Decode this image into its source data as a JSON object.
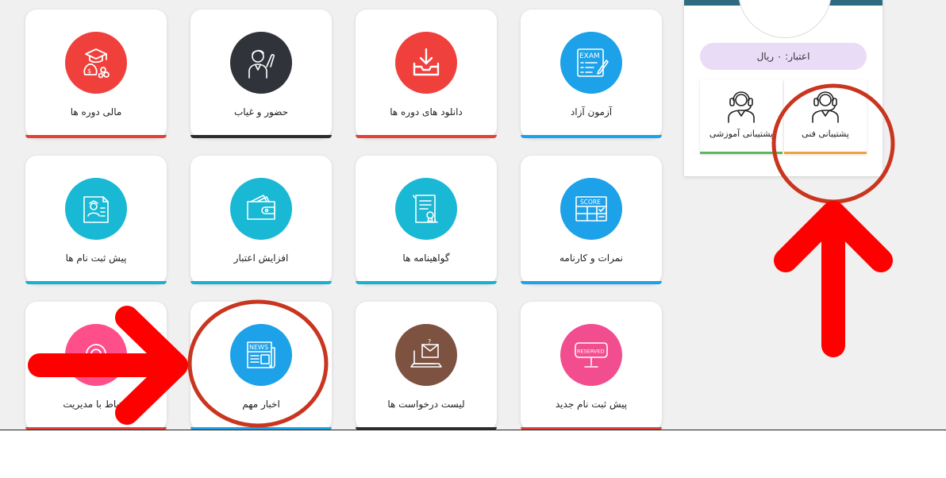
{
  "cards": [
    {
      "label": "مالی دوره ها",
      "icon": "financial-graduation-icon",
      "circle_color": "#f0403c",
      "bar_color": "#e0413a"
    },
    {
      "label": "حضور و غیاب",
      "icon": "attendance-person-icon",
      "circle_color": "#30343a",
      "bar_color": "#2b2d30"
    },
    {
      "label": "دانلود های دوره ها",
      "icon": "download-tray-icon",
      "circle_color": "#f0403c",
      "bar_color": "#e0413a"
    },
    {
      "label": "آزمون آزاد",
      "icon": "exam-icon",
      "circle_color": "#1da1e8",
      "bar_color": "#1da1e8"
    },
    {
      "label": "پیش ثبت نام ها",
      "icon": "pre-registration-icon",
      "circle_color": "#19b8d4",
      "bar_color": "#19b0d0"
    },
    {
      "label": "افزایش اعتبار",
      "icon": "wallet-icon",
      "circle_color": "#19b8d4",
      "bar_color": "#19b0d0"
    },
    {
      "label": "گواهینامه ها",
      "icon": "certificate-icon",
      "circle_color": "#19b8d4",
      "bar_color": "#19b0d0"
    },
    {
      "label": "نمرات و کارنامه",
      "icon": "score-icon",
      "circle_color": "#1da1e8",
      "bar_color": "#1da1e8"
    },
    {
      "label": "ارتباط با مدیریت",
      "icon": "contact-admin-icon",
      "circle_color": "#ff4f8a",
      "bar_color": "#e0413a"
    },
    {
      "label": "اخبار مهم",
      "icon": "news-icon",
      "circle_color": "#1da1e8",
      "bar_color": "#1da1e8"
    },
    {
      "label": "لیست درخواست ها",
      "icon": "requests-laptop-icon",
      "circle_color": "#7d5240",
      "bar_color": "#2b2d30"
    },
    {
      "label": "پیش ثبت نام جدید",
      "icon": "reserved-sign-icon",
      "circle_color": "#f24d8e",
      "bar_color": "#e0413a"
    }
  ],
  "icon_text": {
    "exam": "EXAM",
    "score": "SCORE",
    "news": "NEWS",
    "reserved": "RESERVED"
  },
  "sidebar": {
    "credit": "اعتبار: ۰ ریال",
    "support_items": [
      {
        "label": "پشتیبانی آموزشی",
        "icon": "headset-support-icon",
        "bar_color": "#5cb85c"
      },
      {
        "label": "پشتیبانی فنی",
        "icon": "headset-support-icon",
        "bar_color": "#f0a040"
      }
    ]
  },
  "annotations": {
    "color": "#ff0000",
    "ellipse_color": "#c9351f"
  }
}
